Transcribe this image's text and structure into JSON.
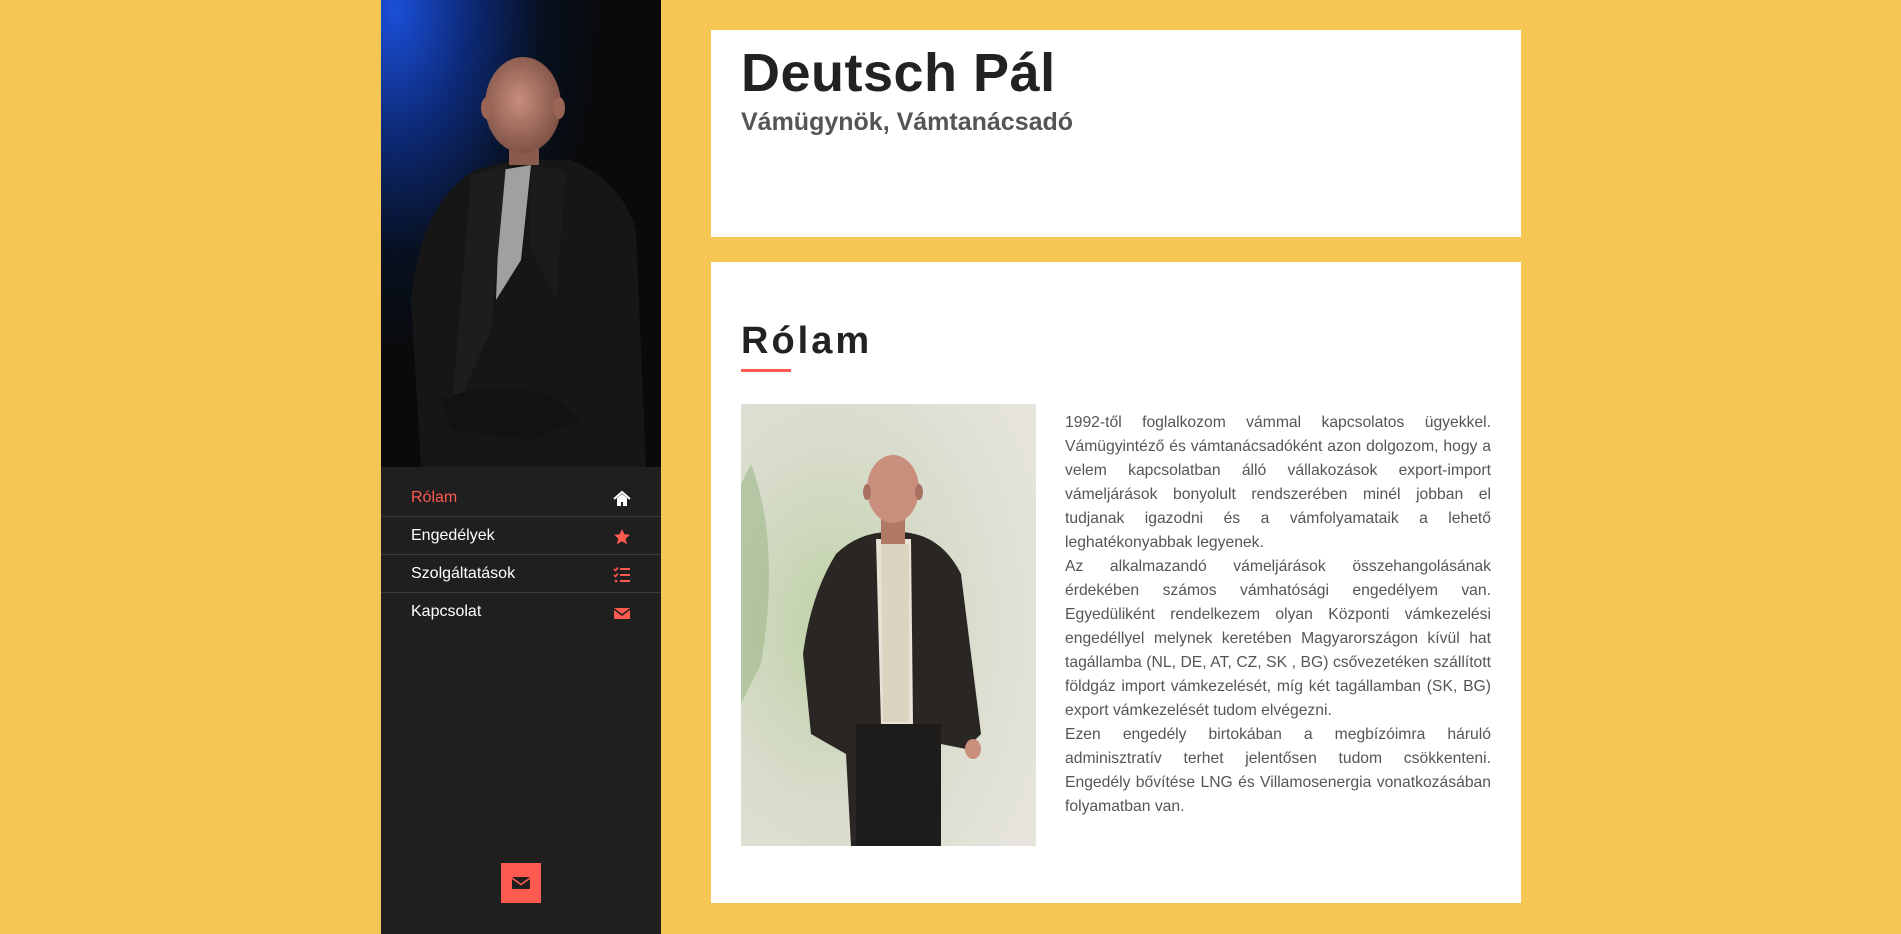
{
  "nav": {
    "items": [
      {
        "label": "Rólam",
        "icon": "home-icon",
        "active": true
      },
      {
        "label": "Engedélyek",
        "icon": "star-icon",
        "active": false
      },
      {
        "label": "Szolgáltatások",
        "icon": "list-icon",
        "active": false
      },
      {
        "label": "Kapcsolat",
        "icon": "envelope-icon",
        "active": false
      }
    ]
  },
  "header": {
    "name": "Deutsch Pál",
    "subtitle": "Vámügynök, Vámtanácsadó"
  },
  "about": {
    "title": "Rólam",
    "paragraphs": [
      "1992-től foglalkozom vámmal kapcsolatos ügyekkel. Vámügyintéző és vámtanácsadóként azon dolgozom, hogy a velem kapcsolatban álló vállakozások export-import vámeljárások bonyolult rendszerében minél jobban el tudjanak igazodni és a vámfolyamataik a lehető leghatékonyabbak legyenek.",
      "Az alkalmazandó vámeljárások összehangolásának érdekében számos vámhatósági engedélyem van. Egyedüliként rendelkezem olyan Központi vámkezelési engedéllyel melynek keretében Magyarországon kívül hat tagállamba (NL, DE, AT, CZ, SK , BG) csővezetéken szállított földgáz import vámkezelését, míg két tagállamban (SK, BG) export vámkezelését tudom elvégezni.",
      "Ezen engedély birtokában a megbízóimra háruló adminisztratív terhet jelentősen tudom csökkenteni. Engedély bővítése LNG és Villamosenergia vonatkozásában folyamatban van."
    ]
  },
  "colors": {
    "background": "#f5c653",
    "sidebar": "#1f1f1f",
    "accent": "#ff5a4f",
    "card": "#ffffff"
  }
}
